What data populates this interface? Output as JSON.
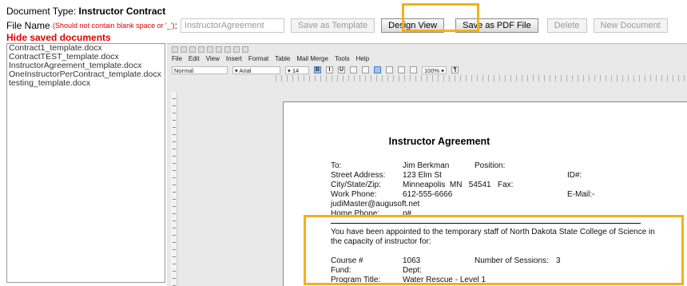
{
  "doc_type": {
    "label": "Document Type:",
    "value": "Instructor Contract"
  },
  "file_name": {
    "label": "File Name",
    "note": "(Should not contain blank space or '_')",
    "colon": ":",
    "value": "InstructorAgreement"
  },
  "buttons": {
    "save_template": "Save as Template",
    "design_view": "Design View",
    "save_pdf": "Save as PDF File",
    "delete": "Delete",
    "new_document": "New Document"
  },
  "hide_link": "Hide saved documents",
  "saved_documents": [
    "Contract1_template.docx",
    "ContractTEST_template.docx",
    "InstructorAgreement_template.docx",
    "OneInstructorPerContract_template.docx",
    "testing_template.docx"
  ],
  "menu": [
    "File",
    "Edit",
    "View",
    "Insert",
    "Format",
    "Table",
    "Mail Merge",
    "Tools",
    "Help"
  ],
  "format_bar": {
    "style": "Normal",
    "font": "Arial",
    "size": "14",
    "zoom": "100%"
  },
  "doc": {
    "title": "Instructor Agreement",
    "to_label": "To:",
    "to_value": "Jim Berkman",
    "position_label": "Position:",
    "street_label": "Street Address:",
    "street_value": "123 Elm St",
    "id_label": "ID#:",
    "city_label": "City/State/Zip:",
    "city_value": "Minneapolis  MN   54541",
    "fax_label": "Fax:",
    "work_label": "Work Phone:",
    "work_value": "612-555-6666",
    "email_label": "E-Mail:-",
    "email_value": "judiMaster@augusoft.net",
    "home_label": "Home Phone:",
    "home_value": "p#",
    "appoint_line1": "You have been appointed to the temporary staff of North Dakota State College of Science in",
    "appoint_line2": "the capacity of instructor for:",
    "course_label": "Course #",
    "course_value": "1063",
    "sessions_label": "Number of Sessions:",
    "sessions_value": "3",
    "fund_label": "Fund:",
    "dept_label": "Dept:",
    "program_label": "Program Title:",
    "program_value": "Water Rescue - Level 1"
  },
  "colors": {
    "highlight": "#f2b11a",
    "warning_red": "#e00000"
  }
}
